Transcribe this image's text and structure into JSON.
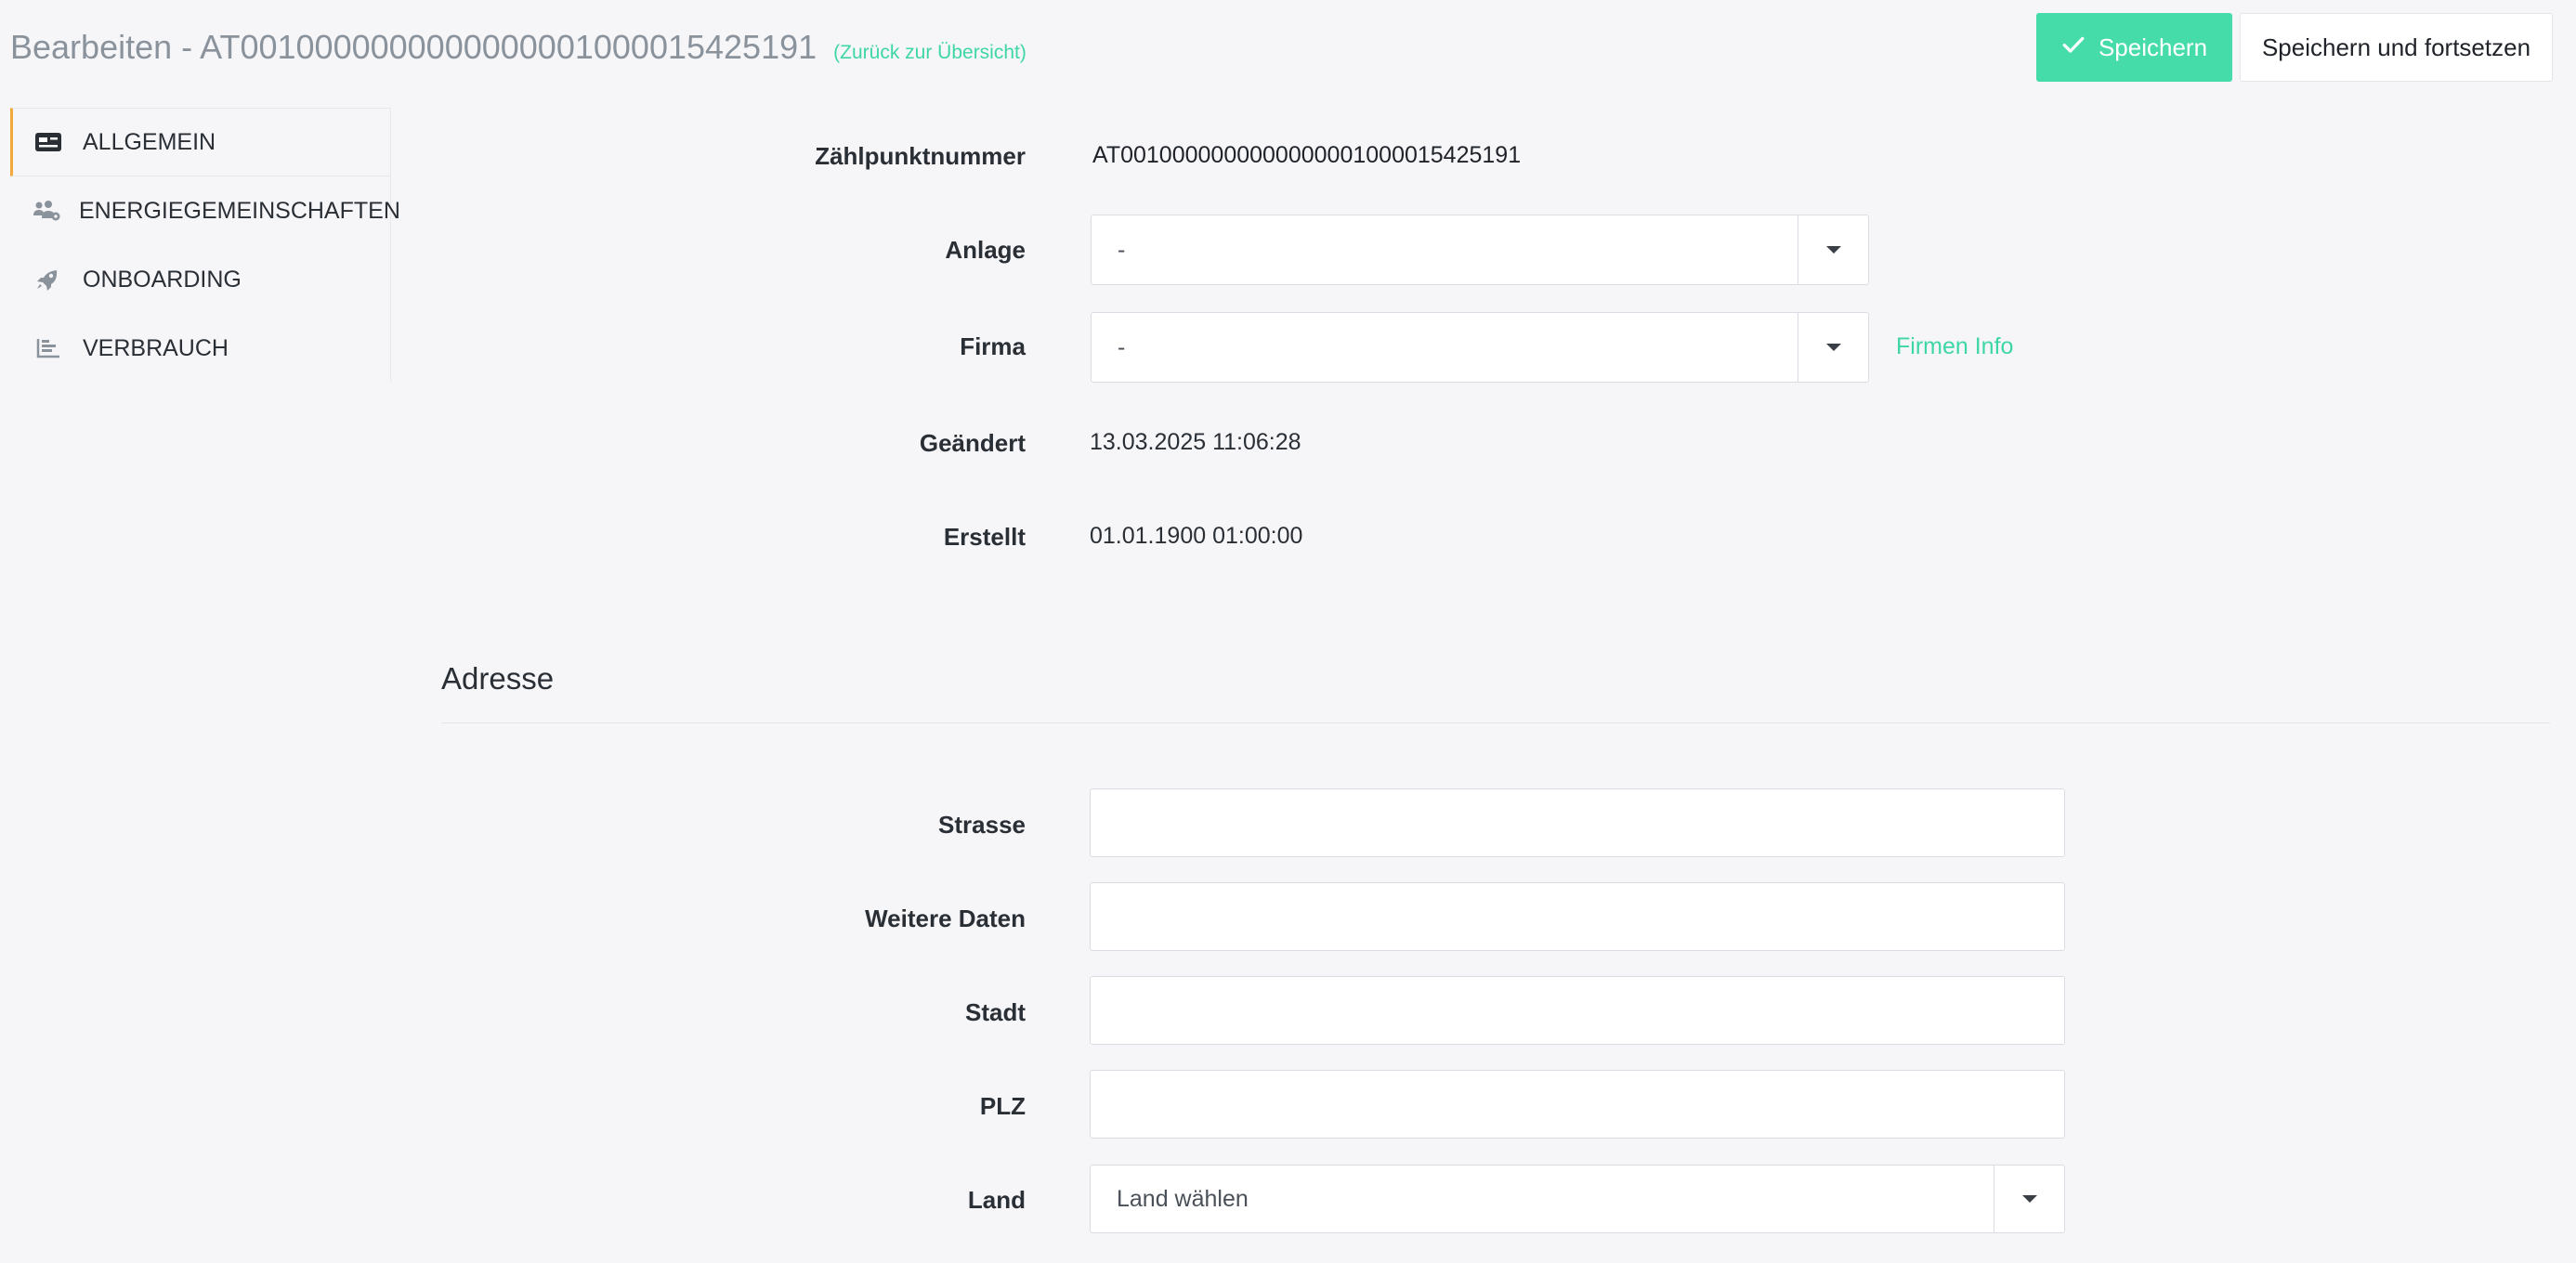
{
  "header": {
    "title": "Bearbeiten - AT0010000000000000001000015425191",
    "back_link": "(Zurück zur Übersicht)",
    "save_label": "Speichern",
    "save_continue_label": "Speichern und fortsetzen"
  },
  "sidebar": {
    "items": [
      {
        "label": "ALLGEMEIN",
        "icon": "id-card-icon"
      },
      {
        "label": "ENERGIEGEMEINSCHAFTEN",
        "icon": "users-gear-icon"
      },
      {
        "label": "ONBOARDING",
        "icon": "rocket-icon"
      },
      {
        "label": "VERBRAUCH",
        "icon": "bar-chart-icon"
      }
    ]
  },
  "general": {
    "zaehlpunkt_label": "Zählpunktnummer",
    "zaehlpunkt_value": "AT0010000000000000001000015425191",
    "anlage_label": "Anlage",
    "anlage_value": "-",
    "firma_label": "Firma",
    "firma_value": "-",
    "firmen_info_link": "Firmen Info",
    "geaendert_label": "Geändert",
    "geaendert_value": "13.03.2025 11:06:28",
    "erstellt_label": "Erstellt",
    "erstellt_value": "01.01.1900 01:00:00"
  },
  "address": {
    "section_title": "Adresse",
    "strasse_label": "Strasse",
    "strasse_value": "",
    "weitere_label": "Weitere Daten",
    "weitere_value": "",
    "stadt_label": "Stadt",
    "stadt_value": "",
    "plz_label": "PLZ",
    "plz_value": "",
    "land_label": "Land",
    "land_placeholder": "Land wählen"
  },
  "colors": {
    "accent": "#46dcaa",
    "link": "#3fd6a6",
    "active_marker": "#f2a93b",
    "background": "#f6f6f9"
  }
}
